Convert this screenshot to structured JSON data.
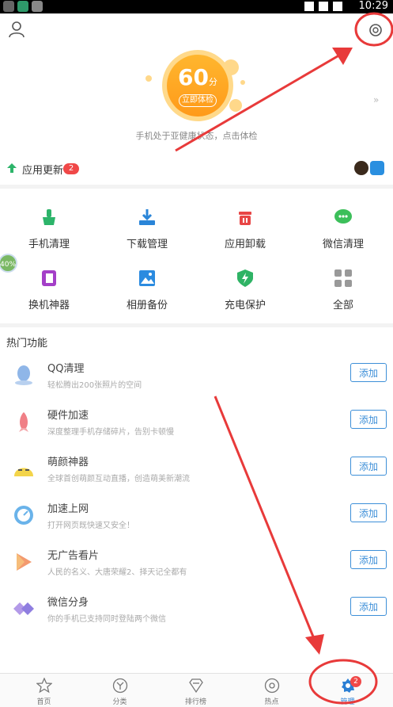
{
  "status_bar": {
    "time": "10:29"
  },
  "header": {
    "score": "60",
    "score_unit": "分",
    "check_button": "立即体检",
    "health_text": "手机处于亚健康状态，点击体检",
    "more_arrows": "»"
  },
  "update": {
    "label": "应用更新",
    "badge": "2"
  },
  "tools": [
    {
      "label": "手机清理",
      "icon": "broom-icon",
      "color": "#2db46a"
    },
    {
      "label": "下载管理",
      "icon": "download-icon",
      "color": "#2a85d8"
    },
    {
      "label": "应用卸载",
      "icon": "trash-icon",
      "color": "#e84646"
    },
    {
      "label": "微信清理",
      "icon": "wechat-icon",
      "color": "#3cbf5a"
    },
    {
      "label": "换机神器",
      "icon": "phone-swap-icon",
      "color": "#a43fc8"
    },
    {
      "label": "相册备份",
      "icon": "photo-icon",
      "color": "#2b8be0"
    },
    {
      "label": "充电保护",
      "icon": "charge-shield-icon",
      "color": "#2fb365"
    },
    {
      "label": "全部",
      "icon": "grid-icon",
      "color": "#999999"
    }
  ],
  "side_badge": "40%",
  "hot": {
    "title": "热门功能",
    "items": [
      {
        "name": "QQ清理",
        "desc": "轻松腾出200张照片的空间",
        "action": "添加",
        "icon": "qq-icon"
      },
      {
        "name": "硬件加速",
        "desc": "深度整理手机存储碎片，告别卡顿慢",
        "action": "添加",
        "icon": "rocket-icon"
      },
      {
        "name": "萌颜神器",
        "desc": "全球首创萌颜互动直播，创造萌美新潮流",
        "action": "添加",
        "icon": "cute-face-icon"
      },
      {
        "name": "加速上网",
        "desc": "打开网页既快速又安全！",
        "action": "添加",
        "icon": "speedometer-icon"
      },
      {
        "name": "无广告看片",
        "desc": "人民的名义、大唐荣耀2、择天记全都有",
        "action": "添加",
        "icon": "play-icon"
      },
      {
        "name": "微信分身",
        "desc": "你的手机已支持同时登陆两个微信",
        "action": "添加",
        "icon": "diamond-icon"
      }
    ]
  },
  "nav": [
    {
      "label": "首页",
      "icon": "star-icon"
    },
    {
      "label": "分类",
      "icon": "category-icon"
    },
    {
      "label": "排行榜",
      "icon": "rank-icon"
    },
    {
      "label": "热点",
      "icon": "hotspot-icon"
    },
    {
      "label": "管理",
      "icon": "manage-gear-icon",
      "badge": "2",
      "active": true
    }
  ],
  "colors": {
    "accent": "#2b7fd4",
    "badge": "#f04848",
    "annotation": "#e83a3a"
  }
}
